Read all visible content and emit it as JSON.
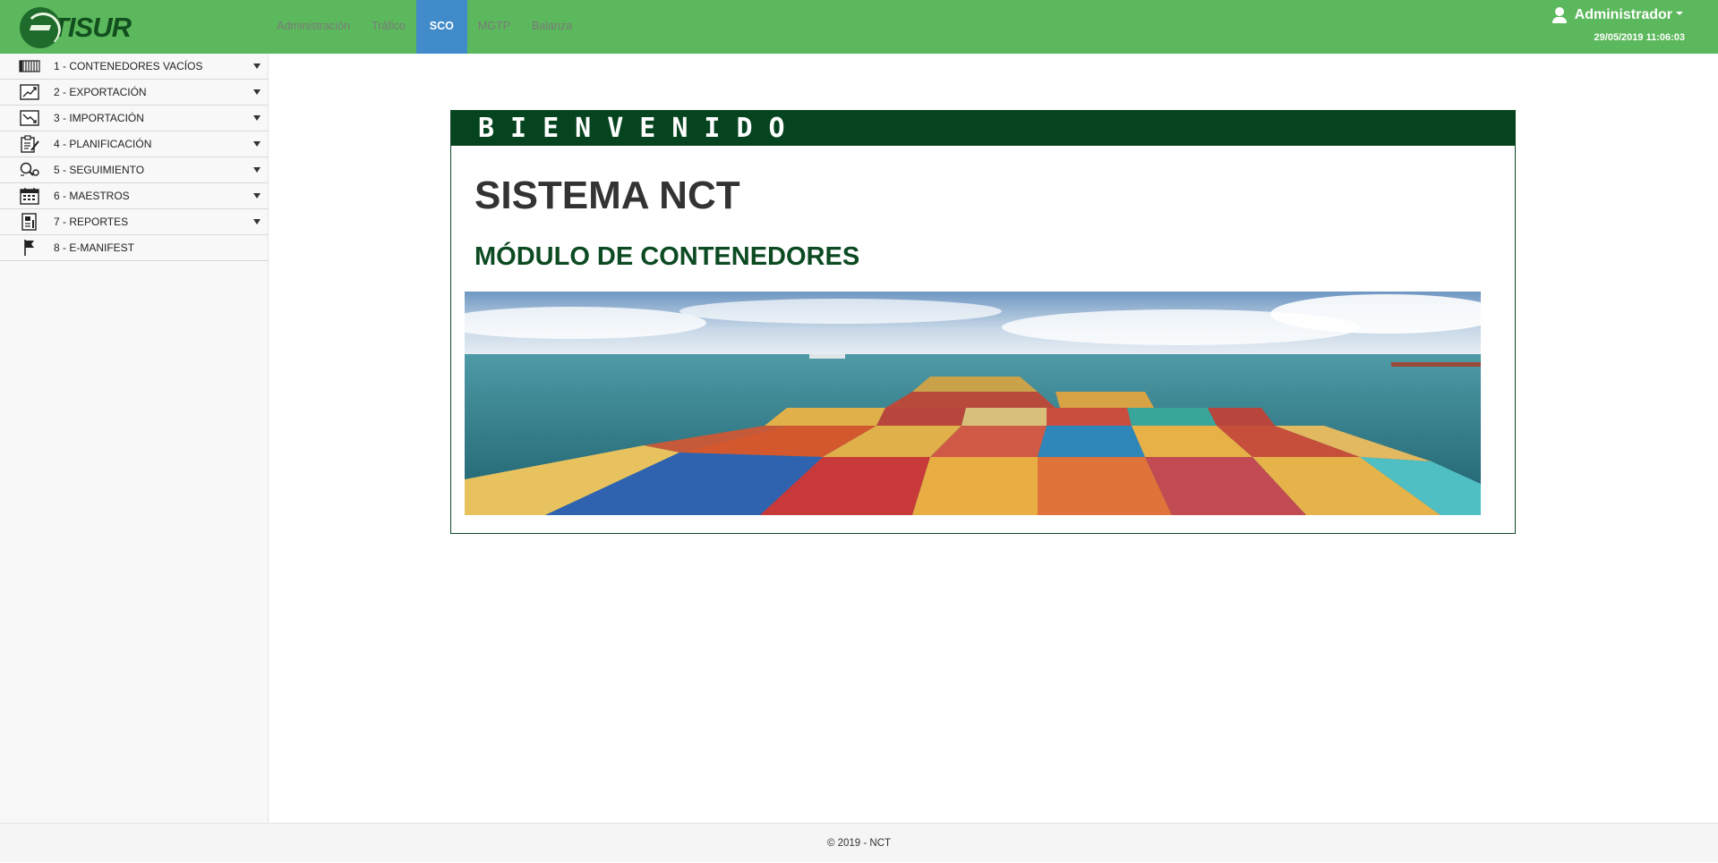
{
  "brand": {
    "logo_text": "TISUR"
  },
  "nav": {
    "tabs": [
      {
        "label": "Administración",
        "active": false
      },
      {
        "label": "Tráfico",
        "active": false
      },
      {
        "label": "SCO",
        "active": true
      },
      {
        "label": "MGTP",
        "active": false
      },
      {
        "label": "Balanza",
        "active": false
      }
    ]
  },
  "user": {
    "name": "Administrador",
    "datetime": "29/05/2019 11:06:03"
  },
  "sidebar": {
    "items": [
      {
        "label": "1 - CONTENEDORES VACÍOS",
        "icon": "container-icon",
        "expandable": true
      },
      {
        "label": "2 - EXPORTACIÓN",
        "icon": "export-chart-icon",
        "expandable": true
      },
      {
        "label": "3 - IMPORTACIÓN",
        "icon": "import-chart-icon",
        "expandable": true
      },
      {
        "label": "4 - PLANIFICACIÓN",
        "icon": "planning-clipboard-icon",
        "expandable": true
      },
      {
        "label": "5 - SEGUIMIENTO",
        "icon": "tracking-magnifier-icon",
        "expandable": true
      },
      {
        "label": "6 - MAESTROS",
        "icon": "calendar-icon",
        "expandable": true
      },
      {
        "label": "7 - REPORTES",
        "icon": "report-icon",
        "expandable": true
      },
      {
        "label": "8 - E-MANIFEST",
        "icon": "flag-icon",
        "expandable": false
      }
    ]
  },
  "welcome": {
    "header": "BIENVENIDO",
    "title": "SISTEMA NCT",
    "subtitle": "MÓDULO DE CONTENEDORES"
  },
  "footer": {
    "text": "© 2019 - NCT"
  },
  "colors": {
    "navbar": "#5cb85c",
    "active_tab": "#428bca",
    "panel_header": "#064420",
    "subtitle": "#0c4a22"
  }
}
